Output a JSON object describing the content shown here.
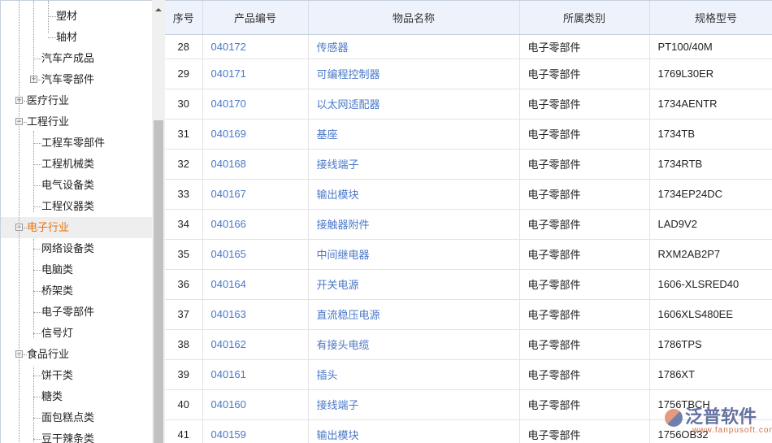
{
  "tree": [
    {
      "label": "塑材",
      "level": 3
    },
    {
      "label": "轴材",
      "level": 3
    },
    {
      "label": "汽车产成品",
      "level": 2
    },
    {
      "label": "汽车零部件",
      "level": 2,
      "toggle": "+"
    },
    {
      "label": "医疗行业",
      "level": 1,
      "toggle": "+"
    },
    {
      "label": "工程行业",
      "level": 1,
      "toggle": "-"
    },
    {
      "label": "工程车零部件",
      "level": 2
    },
    {
      "label": "工程机械类",
      "level": 2
    },
    {
      "label": "电气设备类",
      "level": 2
    },
    {
      "label": "工程仪器类",
      "level": 2
    },
    {
      "label": "电子行业",
      "level": 1,
      "toggle": "-",
      "selected": true
    },
    {
      "label": "网络设备类",
      "level": 2
    },
    {
      "label": "电脑类",
      "level": 2
    },
    {
      "label": "桥架类",
      "level": 2
    },
    {
      "label": "电子零部件",
      "level": 2
    },
    {
      "label": "信号灯",
      "level": 2
    },
    {
      "label": "食品行业",
      "level": 1,
      "toggle": "-"
    },
    {
      "label": "饼干类",
      "level": 2
    },
    {
      "label": "糖类",
      "level": 2
    },
    {
      "label": "面包糕点类",
      "level": 2
    },
    {
      "label": "豆干辣条类",
      "level": 2
    }
  ],
  "columns": [
    "序号",
    "产品编号",
    "物品名称",
    "所属类别",
    "规格型号"
  ],
  "rows": [
    [
      "28",
      "040172",
      "传感器",
      "电子零部件",
      "PT100/40M"
    ],
    [
      "29",
      "040171",
      "可编程控制器",
      "电子零部件",
      "1769L30ER"
    ],
    [
      "30",
      "040170",
      "以太网适配器",
      "电子零部件",
      "1734AENTR"
    ],
    [
      "31",
      "040169",
      "基座",
      "电子零部件",
      "1734TB"
    ],
    [
      "32",
      "040168",
      "接线端子",
      "电子零部件",
      "1734RTB"
    ],
    [
      "33",
      "040167",
      "输出模块",
      "电子零部件",
      "1734EP24DC"
    ],
    [
      "34",
      "040166",
      "接触器附件",
      "电子零部件",
      "LAD9V2"
    ],
    [
      "35",
      "040165",
      "中间继电器",
      "电子零部件",
      "RXM2AB2P7"
    ],
    [
      "36",
      "040164",
      "开关电源",
      "电子零部件",
      "1606-XLSRED40"
    ],
    [
      "37",
      "040163",
      "直流稳压电源",
      "电子零部件",
      "1606XLS480EE"
    ],
    [
      "38",
      "040162",
      "有接头电缆",
      "电子零部件",
      "1786TPS"
    ],
    [
      "39",
      "040161",
      "插头",
      "电子零部件",
      "1786XT"
    ],
    [
      "40",
      "040160",
      "接线端子",
      "电子零部件",
      "1756TBCH"
    ],
    [
      "41",
      "040159",
      "输出模块",
      "电子零部件",
      "1756OB32"
    ]
  ],
  "watermark": {
    "brand": "泛普软件",
    "url": "www.fanpusoft.com"
  }
}
